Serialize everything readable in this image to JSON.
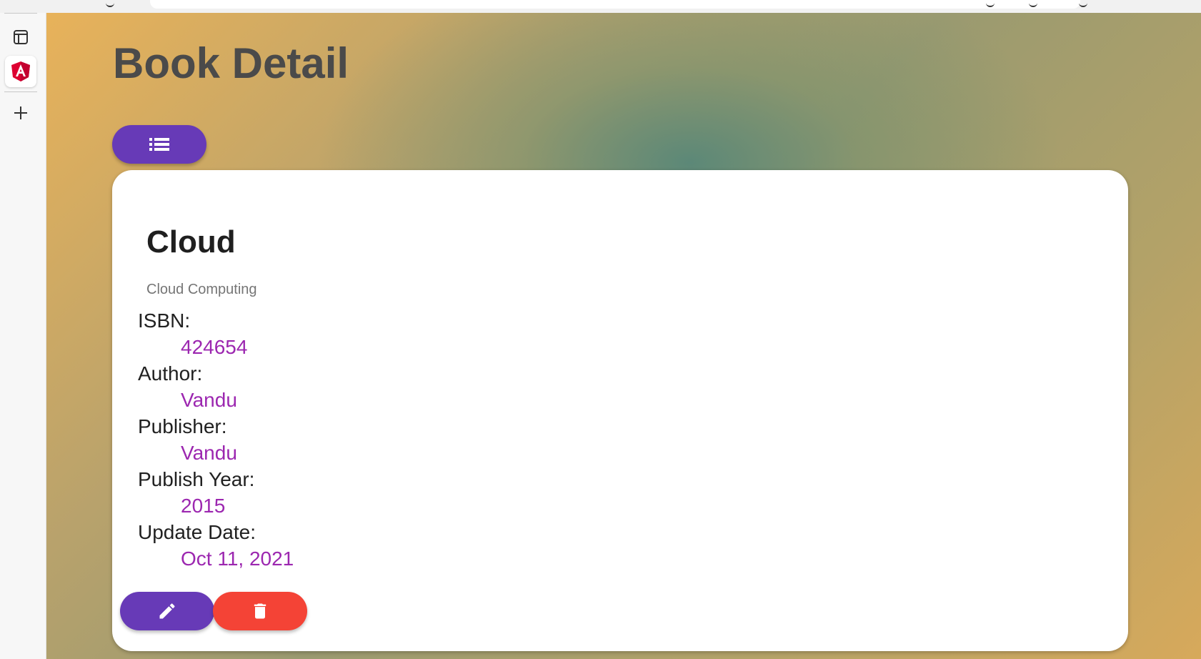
{
  "page": {
    "title": "Book Detail"
  },
  "toolbar": {
    "list_button_icon": "list-icon"
  },
  "sidebar": {
    "items": [
      {
        "icon": "sidebar-panel-icon"
      },
      {
        "icon": "angular-logo-icon",
        "active": true
      },
      {
        "icon": "plus-icon"
      }
    ]
  },
  "book": {
    "title": "Cloud",
    "subtitle": "Cloud Computing",
    "fields": [
      {
        "label": "ISBN:",
        "value": "424654"
      },
      {
        "label": "Author:",
        "value": "Vandu"
      },
      {
        "label": "Publisher:",
        "value": "Vandu"
      },
      {
        "label": "Publish Year:",
        "value": "2015"
      },
      {
        "label": "Update Date:",
        "value": "Oct 11, 2021"
      }
    ]
  },
  "actions": {
    "edit_icon": "edit-icon",
    "delete_icon": "delete-icon"
  },
  "colors": {
    "primary": "#673ab7",
    "warn": "#f44336",
    "accent_text": "#9c27b0",
    "title_text": "#4a4a4a"
  }
}
